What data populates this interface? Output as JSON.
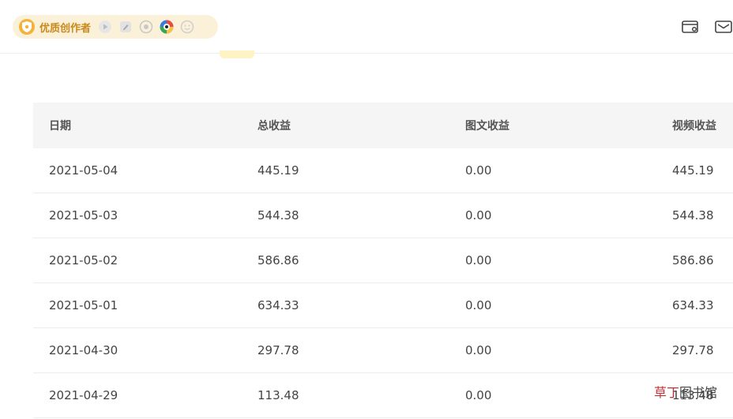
{
  "badge": {
    "label": "优质创作者"
  },
  "table": {
    "headers": [
      "日期",
      "总收益",
      "图文收益",
      "视频收益"
    ],
    "rows": [
      [
        "2021-05-04",
        "445.19",
        "0.00",
        "445.19"
      ],
      [
        "2021-05-03",
        "544.38",
        "0.00",
        "544.38"
      ],
      [
        "2021-05-02",
        "586.86",
        "0.00",
        "586.86"
      ],
      [
        "2021-05-01",
        "634.33",
        "0.00",
        "634.33"
      ],
      [
        "2021-04-30",
        "297.78",
        "0.00",
        "297.78"
      ],
      [
        "2021-04-29",
        "113.48",
        "0.00",
        "113.48"
      ]
    ]
  },
  "watermark": {
    "part1": "草丁",
    "part2": "图书馆"
  },
  "icons": [
    "shield-icon",
    "video-icon",
    "edit-icon",
    "audio-icon",
    "eye-icon",
    "emoji-icon",
    "wallet-icon",
    "mail-icon"
  ],
  "colors": {
    "badge_bg": "#fbf0d8",
    "badge_text": "#c98a1b",
    "header_bg": "#f5f5f5"
  }
}
